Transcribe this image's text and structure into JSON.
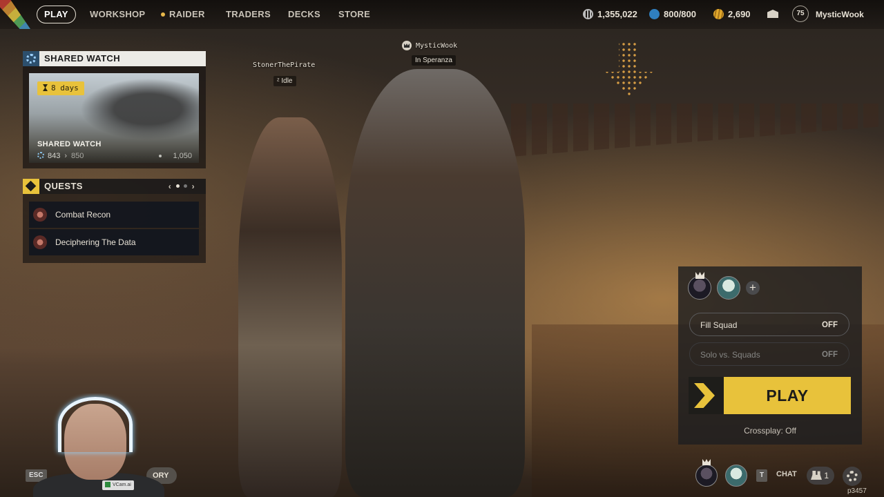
{
  "nav": {
    "items": [
      {
        "label": "PLAY",
        "active": true
      },
      {
        "label": "WORKSHOP"
      },
      {
        "label": "RAIDER"
      },
      {
        "label": "TRADERS"
      },
      {
        "label": "DECKS"
      },
      {
        "label": "STORE"
      }
    ],
    "currencies": [
      {
        "icon": "coins-icon",
        "value": "1,355,022"
      },
      {
        "icon": "raider-token-icon",
        "value": "800/800",
        "color": "#2f7fbf"
      },
      {
        "icon": "gold-icon",
        "value": "2,690",
        "color": "#e2a92c"
      }
    ],
    "mail_icon": "mail-icon",
    "player": {
      "level": "75",
      "name": "MysticWook"
    }
  },
  "shared_watch": {
    "header": "SHARED WATCH",
    "days_left": "8 days",
    "title": "SHARED WATCH",
    "current": "843",
    "next": "850",
    "max": "1,050"
  },
  "quests": {
    "header": "QUESTS",
    "prev": "‹",
    "next": "›",
    "items": [
      {
        "label": "Combat Recon"
      },
      {
        "label": "Deciphering The Data"
      }
    ]
  },
  "world": {
    "player1": {
      "name": "MysticWook",
      "status": "In Speranza"
    },
    "player2": {
      "name": "StonerThePirate",
      "status": "Idle"
    }
  },
  "squad": {
    "add": "+",
    "fill_squad": {
      "label": "Fill Squad",
      "value": "OFF"
    },
    "solo_vs_squads": {
      "label": "Solo vs. Squads",
      "value": "OFF"
    },
    "play_label": "PLAY",
    "crossplay": "Crossplay: Off"
  },
  "bottom": {
    "esc": "ESC",
    "ory": "ORY",
    "chat_key": "T",
    "chat": "CHAT",
    "friends_count": "1",
    "footer_id": "p3457",
    "webcam_watermark": "VCam.ai"
  },
  "colors": {
    "accent": "#e8c23b",
    "panel_light": "#ecebe6"
  }
}
